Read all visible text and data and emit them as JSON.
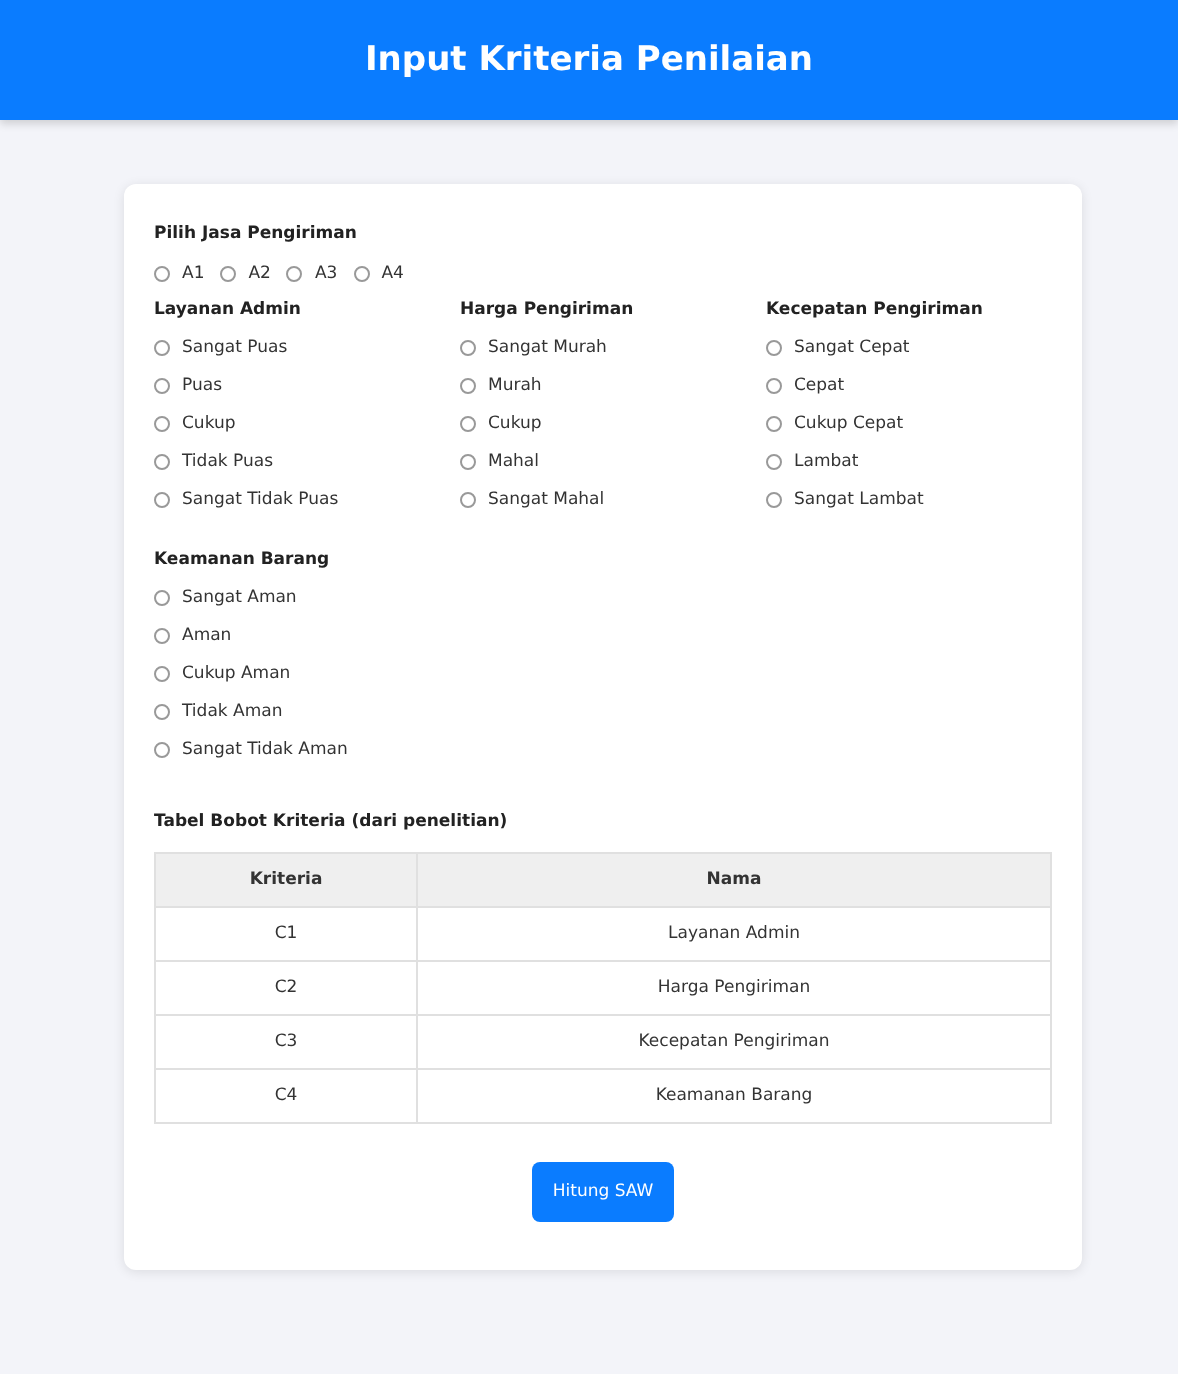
{
  "header": {
    "title": "Input Kriteria Penilaian"
  },
  "service": {
    "label": "Pilih Jasa Pengiriman",
    "options": [
      {
        "label": "A1",
        "selected": false
      },
      {
        "label": "A2",
        "selected": false
      },
      {
        "label": "A3",
        "selected": false
      },
      {
        "label": "A4",
        "selected": false
      }
    ]
  },
  "criteria": [
    {
      "title": "Layanan Admin",
      "options": [
        {
          "label": "Sangat Puas",
          "selected": false
        },
        {
          "label": "Puas",
          "selected": false
        },
        {
          "label": "Cukup",
          "selected": false
        },
        {
          "label": "Tidak Puas",
          "selected": false
        },
        {
          "label": "Sangat Tidak Puas",
          "selected": false
        }
      ]
    },
    {
      "title": "Harga Pengiriman",
      "options": [
        {
          "label": "Sangat Murah",
          "selected": false
        },
        {
          "label": "Murah",
          "selected": false
        },
        {
          "label": "Cukup",
          "selected": false
        },
        {
          "label": "Mahal",
          "selected": false
        },
        {
          "label": "Sangat Mahal",
          "selected": false
        }
      ]
    },
    {
      "title": "Kecepatan Pengiriman",
      "options": [
        {
          "label": "Sangat Cepat",
          "selected": false
        },
        {
          "label": "Cepat",
          "selected": false
        },
        {
          "label": "Cukup Cepat",
          "selected": false
        },
        {
          "label": "Lambat",
          "selected": false
        },
        {
          "label": "Sangat Lambat",
          "selected": false
        }
      ]
    },
    {
      "title": "Keamanan Barang",
      "options": [
        {
          "label": "Sangat Aman",
          "selected": false
        },
        {
          "label": "Aman",
          "selected": false
        },
        {
          "label": "Cukup Aman",
          "selected": false
        },
        {
          "label": "Tidak Aman",
          "selected": false
        },
        {
          "label": "Sangat Tidak Aman",
          "selected": false
        }
      ]
    }
  ],
  "table": {
    "title": "Tabel Bobot Kriteria (dari penelitian)",
    "columns": [
      "Kriteria",
      "Nama"
    ],
    "rows": [
      [
        "C1",
        "Layanan Admin"
      ],
      [
        "C2",
        "Harga Pengiriman"
      ],
      [
        "C3",
        "Kecepatan Pengiriman"
      ],
      [
        "C4",
        "Keamanan Barang"
      ]
    ]
  },
  "button": "Hitung SAW"
}
